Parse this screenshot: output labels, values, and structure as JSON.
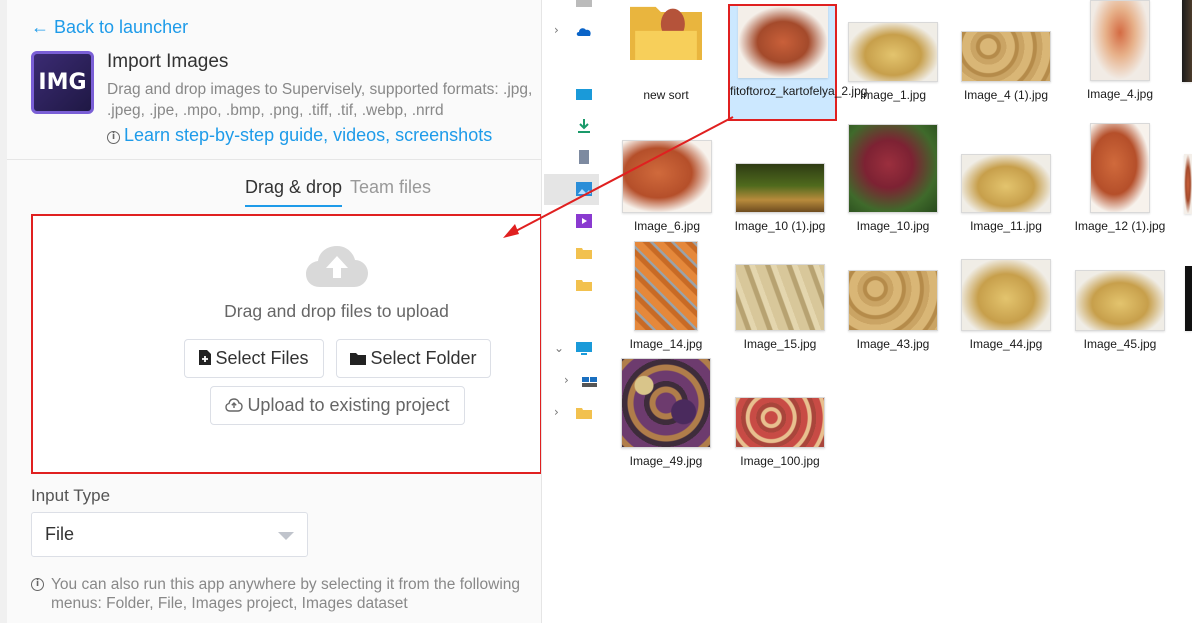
{
  "left_panel": {
    "back_link": "← Back to launcher",
    "app": {
      "logo_text": "IMG",
      "title": "Import Images",
      "description": "Drag and drop images to Supervisely, supported formats: .jpg, .jpeg, .jpe, .mpo, .bmp, .png, .tiff, .tif, .webp, .nrrd",
      "guide_link": "Learn step-by-step guide, videos, screenshots"
    },
    "tabs": [
      {
        "label": "Drag & drop",
        "active": true
      },
      {
        "label": "Team files",
        "active": false
      }
    ],
    "dropzone": {
      "icon": "cloud-upload-icon",
      "text": "Drag and drop files to upload",
      "select_files": "Select Files",
      "select_folder": "Select Folder",
      "upload_existing": "Upload to existing project"
    },
    "input_type": {
      "label": "Input Type",
      "value": "File"
    },
    "note": "You can also run this app anywhere by selecting it from the following menus: Folder, File, Images project, Images dataset"
  },
  "explorer": {
    "nav_icons": [
      "folder-icon",
      "onedrive-icon",
      "desktop-icon",
      "download-icon",
      "document-icon",
      "pictures-icon",
      "videos-icon",
      "folder-icon",
      "folder-icon",
      "this-pc-icon",
      "network-icon",
      "folder-icon"
    ],
    "files": [
      {
        "name": "new sort",
        "kind": "folder"
      },
      {
        "name": "fitoftoroz_kartofelya_2.jpg",
        "kind": "image",
        "selected": true
      },
      {
        "name": "Image_1.jpg",
        "kind": "image"
      },
      {
        "name": "Image_4 (1).jpg",
        "kind": "image"
      },
      {
        "name": "Image_4.jpg",
        "kind": "image"
      },
      {
        "name": "Image_6.jpg",
        "kind": "image"
      },
      {
        "name": "Image_10 (1).jpg",
        "kind": "image"
      },
      {
        "name": "Image_10.jpg",
        "kind": "image"
      },
      {
        "name": "Image_11.jpg",
        "kind": "image"
      },
      {
        "name": "Image_12 (1).jpg",
        "kind": "image"
      },
      {
        "name": "Image_14.jpg",
        "kind": "image"
      },
      {
        "name": "Image_15.jpg",
        "kind": "image"
      },
      {
        "name": "Image_43.jpg",
        "kind": "image"
      },
      {
        "name": "Image_44.jpg",
        "kind": "image"
      },
      {
        "name": "Image_45.jpg",
        "kind": "image"
      },
      {
        "name": "Image_49.jpg",
        "kind": "image"
      },
      {
        "name": "Image_100.jpg",
        "kind": "image"
      }
    ]
  },
  "colors": {
    "accent_blue": "#1e9be9",
    "highlight_red": "#e02020",
    "selection_blue": "#cce8ff"
  }
}
